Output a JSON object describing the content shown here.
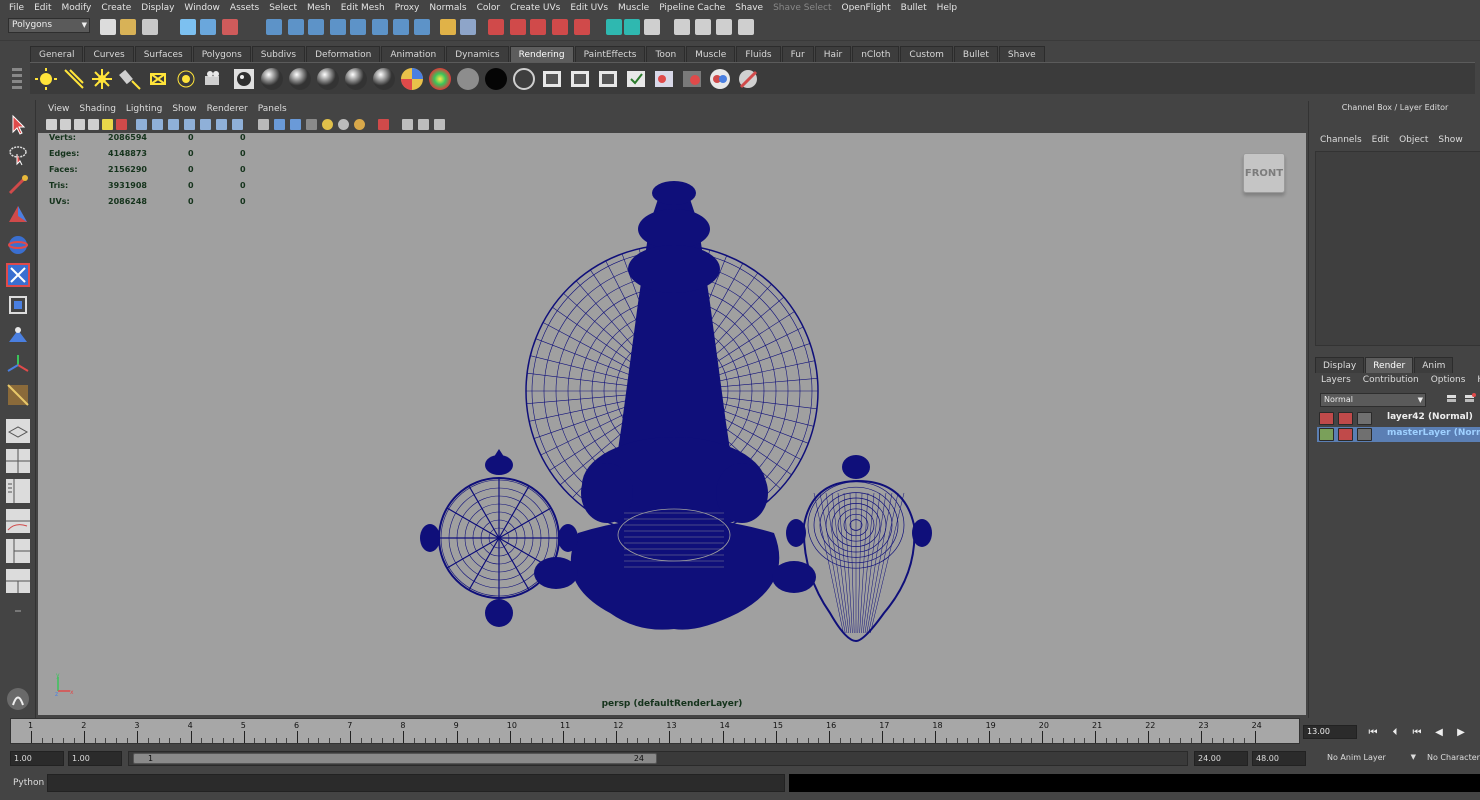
{
  "menubar": [
    "File",
    "Edit",
    "Modify",
    "Create",
    "Display",
    "Window",
    "Assets",
    "Select",
    "Mesh",
    "Edit Mesh",
    "Proxy",
    "Normals",
    "Color",
    "Create UVs",
    "Edit UVs",
    "Muscle",
    "Pipeline Cache",
    "Shave",
    "Shave Select",
    "OpenFlight",
    "Bullet",
    "Help"
  ],
  "statusline": {
    "mode": "Polygons"
  },
  "shelf_tabs": [
    "General",
    "Curves",
    "Surfaces",
    "Polygons",
    "Subdivs",
    "Deformation",
    "Animation",
    "Dynamics",
    "Rendering",
    "PaintEffects",
    "Toon",
    "Muscle",
    "Fluids",
    "Fur",
    "Hair",
    "nCloth",
    "Custom",
    "Bullet",
    "Shave"
  ],
  "shelf_active": "Rendering",
  "panel_menu": [
    "View",
    "Shading",
    "Lighting",
    "Show",
    "Renderer",
    "Panels"
  ],
  "hud": [
    {
      "label": "Verts:",
      "v1": "2086594",
      "v2": "0",
      "v3": "0"
    },
    {
      "label": "Edges:",
      "v1": "4148873",
      "v2": "0",
      "v3": "0"
    },
    {
      "label": "Faces:",
      "v1": "2156290",
      "v2": "0",
      "v3": "0"
    },
    {
      "label": "Tris:",
      "v1": "3931908",
      "v2": "0",
      "v3": "0"
    },
    {
      "label": "UVs:",
      "v1": "2086248",
      "v2": "0",
      "v3": "0"
    }
  ],
  "viewport": {
    "camera_label": "persp (defaultRenderLayer)",
    "viewcube_label": "FRONT",
    "wire_color": "#0f0f7a",
    "background": "#a0a0a0"
  },
  "channel_box": {
    "title": "Channel Box / Layer Editor",
    "menu": [
      "Channels",
      "Edit",
      "Object",
      "Show"
    ]
  },
  "layer_editor": {
    "tabs": [
      "Display",
      "Render",
      "Anim"
    ],
    "active_tab": "Render",
    "menu": [
      "Layers",
      "Contribution",
      "Options",
      "Help"
    ],
    "blend_mode": "Normal",
    "layers": [
      {
        "name": "layer42 (Normal)",
        "selected": false
      },
      {
        "name": "masterLayer (Normal)",
        "selected": true
      }
    ]
  },
  "timeline": {
    "ticks": [
      "1",
      "2",
      "3",
      "4",
      "5",
      "6",
      "7",
      "8",
      "9",
      "10",
      "11",
      "12",
      "13",
      "14",
      "15",
      "16",
      "17",
      "18",
      "19",
      "20",
      "21",
      "22",
      "23",
      "24"
    ],
    "current_frame": "13.00"
  },
  "range": {
    "start": "1.00",
    "playback_start": "1.00",
    "handle_start": "1",
    "handle_end": "24",
    "playback_end": "24.00",
    "end": "48.00",
    "anim_layer": "No Anim Layer",
    "character": "No Character Set"
  },
  "command": {
    "language": "Python"
  }
}
